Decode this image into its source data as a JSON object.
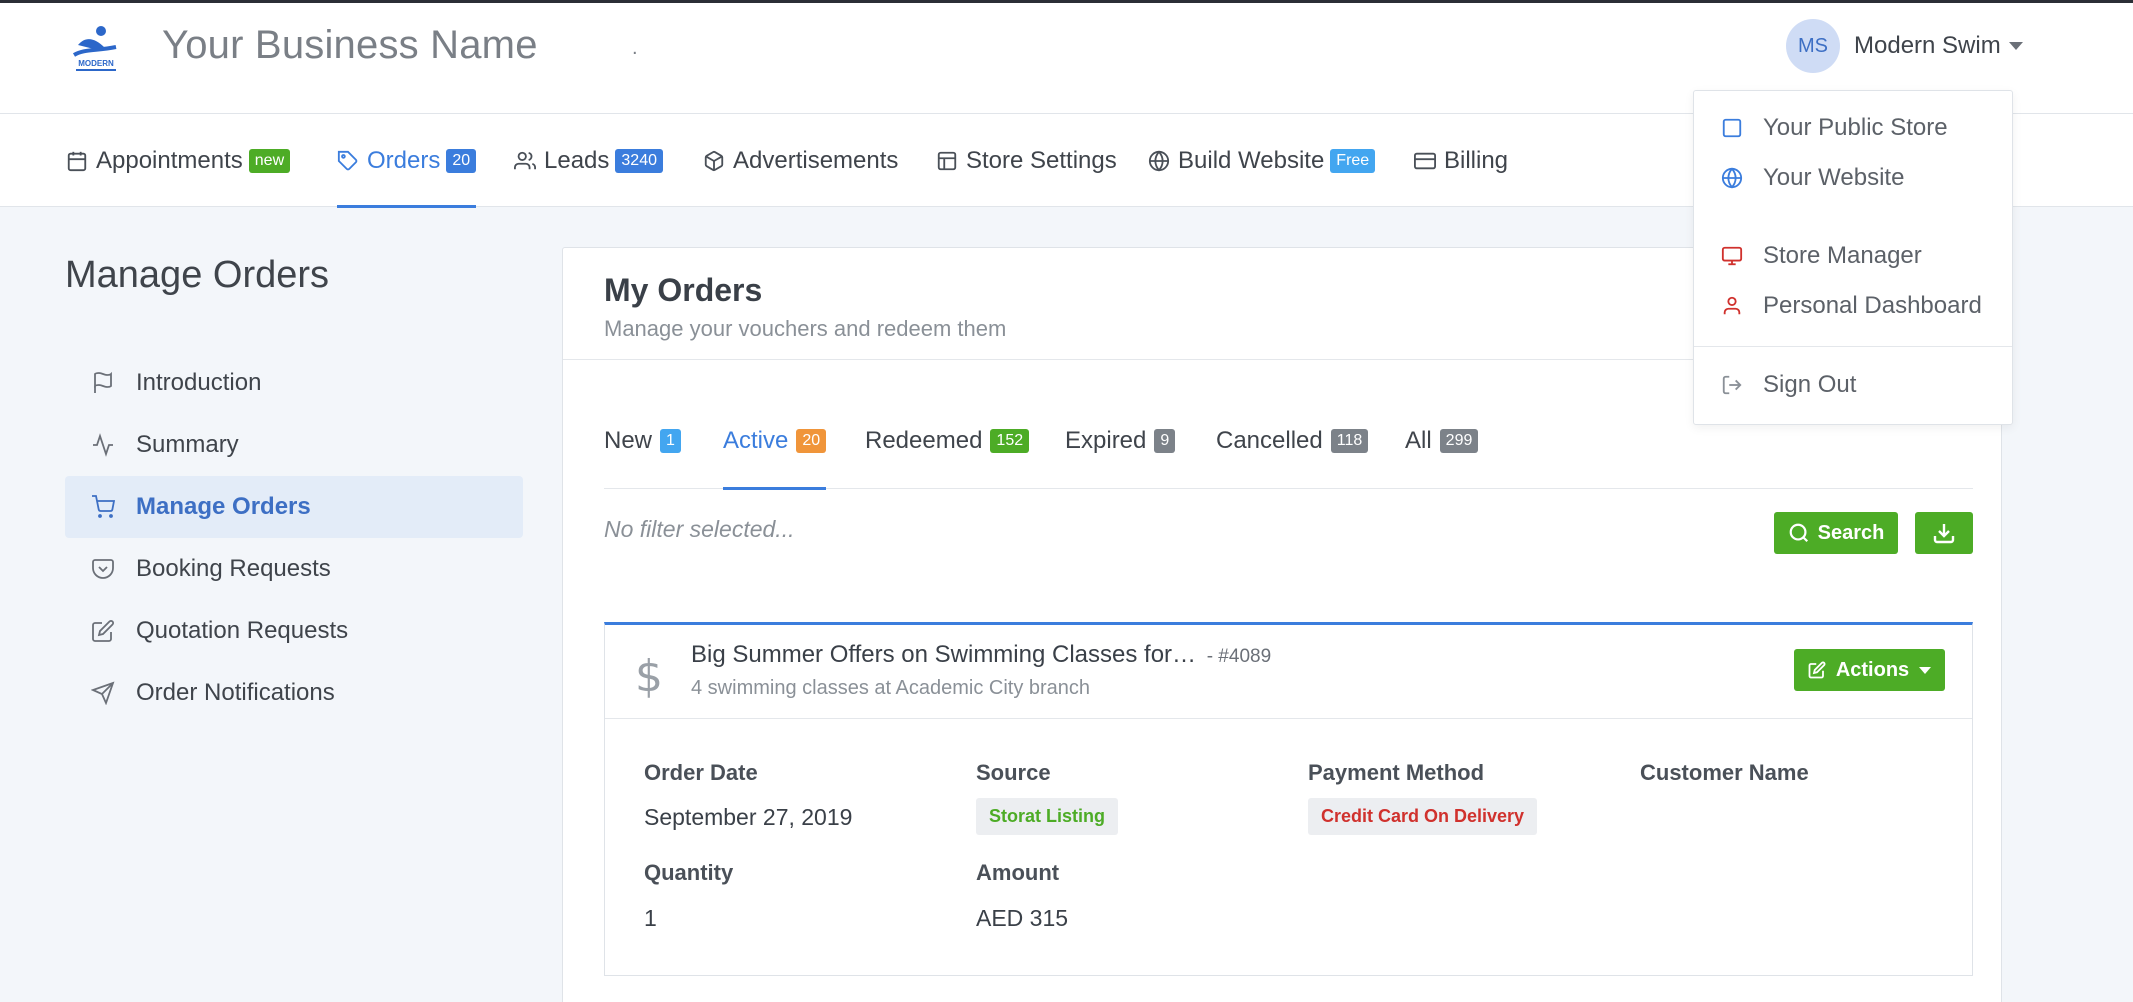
{
  "header": {
    "logo_text": "MODERN",
    "business_name": "Your Business Name",
    "dot": ".",
    "user": {
      "initials": "MS",
      "name": "Modern Swim"
    }
  },
  "nav": {
    "items": [
      {
        "label": "Appointments",
        "badge": "new",
        "icon": "calendar-icon"
      },
      {
        "label": "Orders",
        "badge": "20",
        "icon": "tag-icon",
        "active": true
      },
      {
        "label": "Leads",
        "badge": "3240",
        "icon": "users-icon"
      },
      {
        "label": "Advertisements",
        "icon": "box-icon"
      },
      {
        "label": "Store Settings",
        "icon": "layout-icon"
      },
      {
        "label": "Build Website",
        "badge": "Free",
        "icon": "globe-icon"
      },
      {
        "label": "Billing",
        "icon": "credit-card-icon"
      }
    ]
  },
  "sidebar": {
    "title": "Manage Orders",
    "items": [
      {
        "label": "Introduction",
        "icon": "flag-icon"
      },
      {
        "label": "Summary",
        "icon": "activity-icon"
      },
      {
        "label": "Manage Orders",
        "icon": "cart-icon",
        "active": true
      },
      {
        "label": "Booking Requests",
        "icon": "pocket-icon"
      },
      {
        "label": "Quotation Requests",
        "icon": "edit-icon"
      },
      {
        "label": "Order Notifications",
        "icon": "send-icon"
      }
    ]
  },
  "main": {
    "title": "My Orders",
    "subtitle": "Manage your vouchers and redeem them",
    "tabs": [
      {
        "label": "New",
        "count": "1"
      },
      {
        "label": "Active",
        "count": "20",
        "active": true
      },
      {
        "label": "Redeemed",
        "count": "152"
      },
      {
        "label": "Expired",
        "count": "9"
      },
      {
        "label": "Cancelled",
        "count": "118"
      },
      {
        "label": "All",
        "count": "299"
      }
    ],
    "filter_text": "No filter selected...",
    "search_label": "Search",
    "order": {
      "title": "Big Summer Offers on Swimming Classes for…",
      "number": "- #4089",
      "subtitle": "4 swimming classes at Academic City branch",
      "actions_label": "Actions",
      "fields": {
        "order_date_label": "Order Date",
        "order_date": "September 27, 2019",
        "source_label": "Source",
        "source": "Storat Listing",
        "payment_label": "Payment Method",
        "payment": "Credit Card On Delivery",
        "customer_label": "Customer Name",
        "quantity_label": "Quantity",
        "quantity": "1",
        "amount_label": "Amount",
        "amount": "AED 315"
      }
    }
  },
  "user_dropdown": {
    "items": [
      {
        "label": "Your Public Store",
        "icon": "square-icon"
      },
      {
        "label": "Your Website",
        "icon": "globe-icon"
      },
      {
        "label": "Store Manager",
        "icon": "monitor-icon"
      },
      {
        "label": "Personal Dashboard",
        "icon": "user-icon"
      },
      {
        "label": "Sign Out",
        "icon": "log-out-icon"
      }
    ]
  },
  "colors": {
    "accent": "#3b7ddd",
    "success": "#4dac26",
    "warning": "#f0953a",
    "danger": "#d0312d",
    "muted": "#7c8289"
  }
}
